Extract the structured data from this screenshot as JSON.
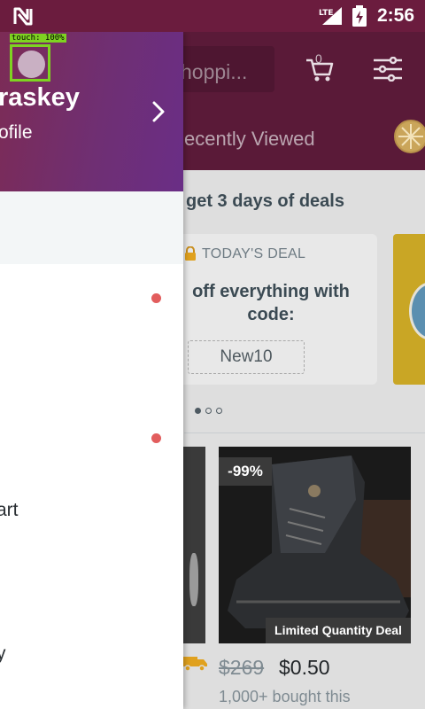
{
  "status_bar": {
    "time": "2:56",
    "network": "LTE",
    "icons": [
      "n-logo-icon",
      "lte-signal-icon",
      "battery-charging-icon"
    ]
  },
  "header": {
    "search_placeholder": "hoppi...",
    "cart_count": "0",
    "tab_label": "ecently Viewed"
  },
  "deals": {
    "heading": "get 3 days of deals",
    "label": "TODAY'S DEAL",
    "text": "off everything with code:",
    "code": "New10",
    "carousel_pages": 3,
    "carousel_active": 1
  },
  "product": {
    "discount": "-99%",
    "badge": "Limited Quantity Deal",
    "old_price": "$269",
    "new_price": "$0.50",
    "sold": "1,000+ bought this"
  },
  "drawer": {
    "user_name": "raskey",
    "profile_link": "ofile",
    "menu_items": [
      {
        "label": "art"
      },
      {
        "label": "y"
      }
    ]
  },
  "overlay": {
    "touch_label": "touch: 100%",
    "accent": "#7ed321"
  },
  "colors": {
    "header": "#5a1a38",
    "drawer_gradient_start": "#7c2b55",
    "drawer_gradient_end": "#6a2e86",
    "notification_dot": "#e25d5d"
  }
}
